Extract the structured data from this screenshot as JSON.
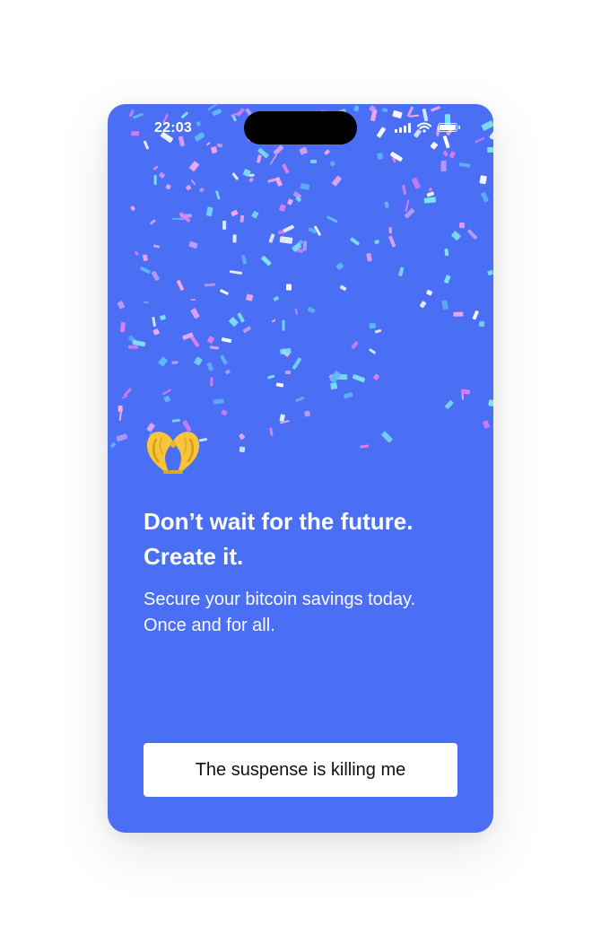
{
  "status_bar": {
    "time": "22:03"
  },
  "onboarding": {
    "emoji": "🫶",
    "emoji_name": "heart-hands",
    "headline_line1": "Don’t wait for the future.",
    "headline_line2": "Create it.",
    "subtext_line1": "Secure your bitcoin savings today.",
    "subtext_line2": "Once and for all."
  },
  "cta": {
    "label": "The suspense is killing me"
  },
  "colors": {
    "background": "#4a6ff5",
    "button_background": "#ffffff",
    "button_text": "#111111",
    "confetti": [
      "#ffffff",
      "#e57ef5",
      "#c79ff7",
      "#7de7f0",
      "#5fb9f7",
      "#f6a9f0"
    ]
  }
}
